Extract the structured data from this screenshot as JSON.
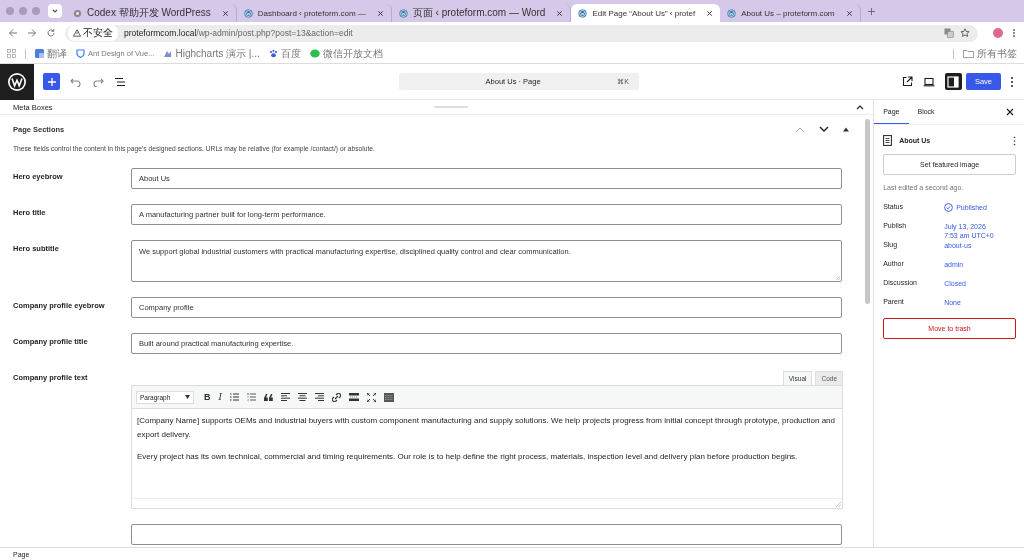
{
  "browser": {
    "tabs": [
      {
        "title": "Codex 帮助开发 WordPress",
        "kind": "gear",
        "selected": false
      },
      {
        "title": "Dashboard ‹ proteform.com —",
        "kind": "wordpress",
        "selected": false
      },
      {
        "title": "页面 ‹ proteform.com — Word",
        "kind": "wordpress",
        "selected": false
      },
      {
        "title": "Edit Page “About Us” ‹ protef",
        "kind": "wordpress",
        "selected": true
      },
      {
        "title": "About Us – proteform.com",
        "kind": "wordpress",
        "selected": false
      }
    ],
    "security_label": "不安全",
    "url_host": "proteformcom.local",
    "url_path": "/wp-admin/post.php?post=13&action=edit",
    "bookmarks": [
      {
        "title": "翻译",
        "kind": "translate"
      },
      {
        "title": "Ant Design of Vue...",
        "kind": "shield"
      },
      {
        "title": "Highcharts 演示 |...",
        "kind": "chart"
      },
      {
        "title": "百度",
        "kind": "paw"
      },
      {
        "title": "微信开放文档",
        "kind": "chat"
      }
    ],
    "bookmarks_folder": "所有书签"
  },
  "editor_header": {
    "document_title": "About Us · Page",
    "shortcut": "⌘K",
    "save": "Save",
    "sidebar_open": true
  },
  "meta_boxes": {
    "title": "Meta Boxes"
  },
  "panel": {
    "title": "Page Sections",
    "expanded": true,
    "description": "These fields control the content in this page's designed sections. URLs may be relative (for example /contact/) or absolute.",
    "fields": [
      {
        "kind": "input",
        "label": "Hero eyebrow",
        "value": "About Us"
      },
      {
        "kind": "input",
        "label": "Hero title",
        "value": "A manufacturing partner built for long-term performance."
      },
      {
        "kind": "textarea",
        "label": "Hero subtitle",
        "value": "We support global industrial customers with practical manufacturing expertise, disciplined quality control and clear communication."
      },
      {
        "kind": "input",
        "label": "Company profile eyebrow",
        "value": "Company profile"
      },
      {
        "kind": "input",
        "label": "Company profile title",
        "value": "Built around practical manufacturing expertise."
      },
      {
        "kind": "editor",
        "label": "Company profile text",
        "tabs": [
          {
            "label": "Visual",
            "selected": true
          },
          {
            "label": "Code",
            "selected": false
          }
        ],
        "format": "Paragraph",
        "toolbar": [
          {
            "kind": "bold",
            "glyph": "B"
          },
          {
            "kind": "italic",
            "glyph": "I"
          },
          {
            "kind": "bullets"
          },
          {
            "kind": "numbers"
          },
          {
            "kind": "quote"
          },
          {
            "kind": "align-left"
          },
          {
            "kind": "align-center"
          },
          {
            "kind": "align-right"
          },
          {
            "kind": "link"
          },
          {
            "kind": "more"
          },
          {
            "kind": "fullscreen"
          },
          {
            "kind": "kitchen"
          }
        ],
        "paragraphs": [
          "[Company Name] supports OEMs and industrial buyers with custom component manufacturing and supply solutions. We help projects progress from initial concept through prototype, production and export delivery.",
          "Every project has its own technical, commercial and timing requirements. Our role is to help define the right process, materials, inspection level and delivery plan before production begins."
        ]
      },
      {
        "kind": "input"
      }
    ]
  },
  "sidebar": {
    "tabs": [
      {
        "label": "Page",
        "selected": true
      },
      {
        "label": "Block",
        "selected": false
      }
    ],
    "page_title": "About Us",
    "featured_image_button": "Set featured image",
    "last_edited": "Last edited a second ago.",
    "rows": [
      {
        "label": "Status",
        "value": "Published",
        "kind": "status"
      },
      {
        "label": "Publish",
        "value": "July 13, 2026\n7:53 am UTC+0",
        "kind": "link"
      },
      {
        "label": "Slug",
        "value": "about-us",
        "kind": "link"
      },
      {
        "label": "Author",
        "value": "admin",
        "kind": "link"
      },
      {
        "label": "Discussion",
        "value": "Closed",
        "kind": "link"
      },
      {
        "label": "Parent",
        "value": "None",
        "kind": "link"
      }
    ],
    "trash_button": "Move to trash"
  },
  "footer": {
    "breadcrumb": "Page"
  }
}
